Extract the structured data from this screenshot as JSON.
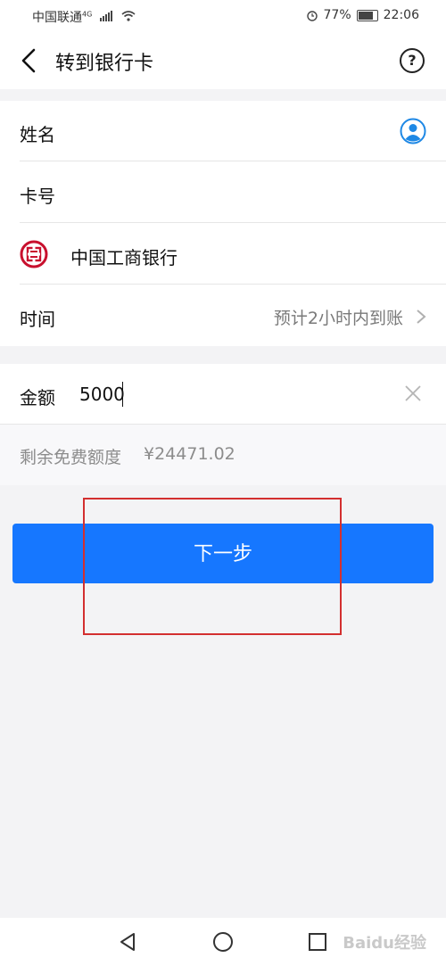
{
  "status_bar": {
    "carrier": "中国联通",
    "network": "4G",
    "battery": "77%",
    "time": "22:06"
  },
  "header": {
    "title": "转到银行卡",
    "help": "?"
  },
  "form": {
    "name_label": "姓名",
    "card_label": "卡号",
    "bank_name": "中国工商银行",
    "time_label": "时间",
    "time_value": "预计2小时内到账"
  },
  "amount": {
    "label": "金额",
    "value": "5000"
  },
  "quota": {
    "label": "剩余免费额度",
    "value": "¥24471.02"
  },
  "next_button": {
    "label": "下一步"
  },
  "watermark": "Baidu经验",
  "colors": {
    "primary": "#1677ff",
    "highlight": "#d32f2f",
    "bank_red": "#c8102e",
    "contact_blue": "#1e88e5"
  }
}
